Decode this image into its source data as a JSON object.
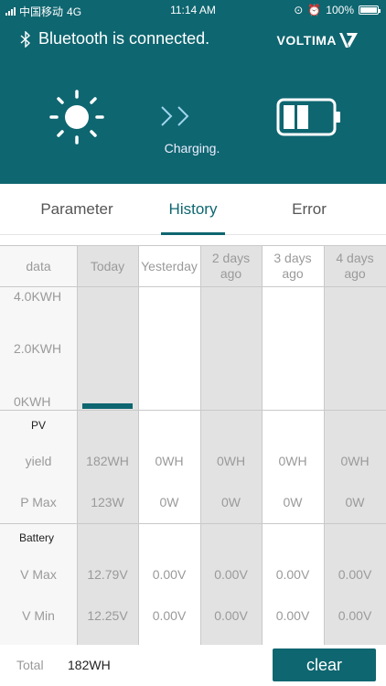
{
  "status_bar": {
    "carrier": "中国移动",
    "network": "4G",
    "time": "11:14 AM",
    "battery": "100%"
  },
  "header": {
    "bluetooth_text": "Bluetooth is connected.",
    "brand": "VOLTIMA",
    "charging_text": "Charging.",
    "accent_color": "#0e6670"
  },
  "tabs": [
    {
      "label": "Parameter",
      "active": false
    },
    {
      "label": "History",
      "active": true
    },
    {
      "label": "Error",
      "active": false
    }
  ],
  "table": {
    "corner": "data",
    "days": [
      "Today",
      "Yesterday",
      "2 days ago",
      "3 days ago",
      "4 days ago"
    ],
    "chart": {
      "y_ticks": [
        "4.0KWH",
        "2.0KWH",
        "0KWH"
      ],
      "ylim_wh": [
        0,
        4000
      ],
      "values_wh": [
        182,
        0,
        0,
        0,
        0
      ]
    },
    "pv": {
      "title": "PV",
      "rows": [
        {
          "label": "yield",
          "values": [
            "182WH",
            "0WH",
            "0WH",
            "0WH",
            "0WH"
          ]
        },
        {
          "label": "P Max",
          "values": [
            "123W",
            "0W",
            "0W",
            "0W",
            "0W"
          ]
        }
      ]
    },
    "battery": {
      "title": "Battery",
      "rows": [
        {
          "label": "V Max",
          "values": [
            "12.79V",
            "0.00V",
            "0.00V",
            "0.00V",
            "0.00V"
          ]
        },
        {
          "label": "V Min",
          "values": [
            "12.25V",
            "0.00V",
            "0.00V",
            "0.00V",
            "0.00V"
          ]
        }
      ]
    }
  },
  "footer": {
    "total_label": "Total",
    "total_value": "182WH",
    "clear_label": "clear"
  }
}
